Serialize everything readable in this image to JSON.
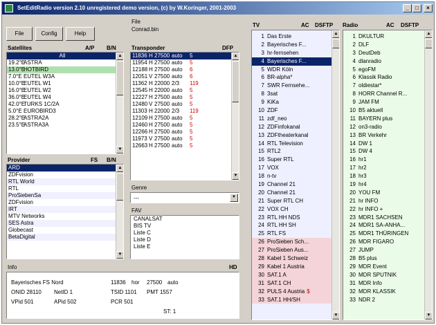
{
  "window": {
    "title": "SetEditRadio version 2.10 unregistered demo version, (c) by W.Koringer, 2001-2003",
    "min_label": "_",
    "max_label": "□",
    "close_label": "×"
  },
  "toolbar": {
    "file_label": "File",
    "config_label": "Config",
    "help_label": "Help"
  },
  "file": {
    "label": "File",
    "value": "Conrad.bin"
  },
  "satellites": {
    "header": "Satellites",
    "col_ap": "A/P",
    "col_dis": "B/N",
    "items": [
      {
        "pos": "",
        "name": "All",
        "selected": true
      },
      {
        "pos": "19.2°E",
        "name": "ASTRA"
      },
      {
        "pos": "13.0°E",
        "name": "HOTBIRD",
        "highlight": true
      },
      {
        "pos": "7.0°E",
        "name": "EUTEL W3A"
      },
      {
        "pos": "10.0°E",
        "name": "EUTEL W1"
      },
      {
        "pos": "16.0°E",
        "name": "EUTEL W2"
      },
      {
        "pos": "36.0°E",
        "name": "EUTEL W4"
      },
      {
        "pos": "42.0°E",
        "name": "TURKS 1C/2A"
      },
      {
        "pos": "5.0°E",
        "name": "EUROBIRD3"
      },
      {
        "pos": "28.2°E",
        "name": "ASTRA2A"
      },
      {
        "pos": "23.5°E",
        "name": "ASTRA3A"
      }
    ]
  },
  "transponders": {
    "header": "Transponder",
    "col_dis": "DFP",
    "items": [
      {
        "freq": "11836",
        "pol": "H",
        "sr": "27500",
        "fec": "auto",
        "n": "5",
        "selected": true
      },
      {
        "freq": "11954",
        "pol": "H",
        "sr": "27500",
        "fec": "auto",
        "n": "5"
      },
      {
        "freq": "12188",
        "pol": "H",
        "sr": "27500",
        "fec": "auto",
        "n": "6"
      },
      {
        "freq": "12051",
        "pol": "V",
        "sr": "27500",
        "fec": "auto",
        "n": "6"
      },
      {
        "freq": "11362",
        "pol": "H",
        "sr": "22000",
        "fec": "2/3",
        "n": "119"
      },
      {
        "freq": "12545",
        "pol": "H",
        "sr": "22000",
        "fec": "auto",
        "n": "5"
      },
      {
        "freq": "12227",
        "pol": "H",
        "sr": "27500",
        "fec": "auto",
        "n": "5"
      },
      {
        "freq": "12480",
        "pol": "V",
        "sr": "27500",
        "fec": "auto",
        "n": "5"
      },
      {
        "freq": "11303",
        "pol": "H",
        "sr": "22000",
        "fec": "2/3",
        "n": "119"
      },
      {
        "freq": "12109",
        "pol": "H",
        "sr": "27500",
        "fec": "auto",
        "n": "5"
      },
      {
        "freq": "12460",
        "pol": "H",
        "sr": "27500",
        "fec": "auto",
        "n": "5"
      },
      {
        "freq": "12266",
        "pol": "H",
        "sr": "27500",
        "fec": "auto",
        "n": "5"
      },
      {
        "freq": "11973",
        "pol": "V",
        "sr": "27500",
        "fec": "auto",
        "n": "5"
      },
      {
        "freq": "12663",
        "pol": "H",
        "sr": "27500",
        "fec": "auto",
        "n": "5"
      }
    ]
  },
  "providers": {
    "header": "Provider",
    "col_fs": "FS",
    "col_dis": "B/N",
    "items": [
      {
        "name": "ARD",
        "selected": true
      },
      {
        "name": "ZDFvision"
      },
      {
        "name": "RTL World"
      },
      {
        "name": "RTL"
      },
      {
        "name": "ProSiebenSa"
      },
      {
        "name": "ZDFvision"
      },
      {
        "name": "IRT"
      },
      {
        "name": "MTV Networks"
      },
      {
        "name": "SES Astra"
      },
      {
        "name": "Globecast"
      },
      {
        "name": "BetaDigital"
      }
    ]
  },
  "genre": {
    "label": "Genre",
    "value": "---"
  },
  "fav": {
    "label": "FAV",
    "items": [
      {
        "name": "CANALSAT"
      },
      {
        "name": "BIS TV"
      },
      {
        "name": "Liste  C"
      },
      {
        "name": "Liste  D"
      },
      {
        "name": "Liste  E"
      }
    ]
  },
  "info": {
    "label": "Info",
    "hd": "HD",
    "name": "Bayerisches FS Nord",
    "freq": "11836",
    "pol": "hor",
    "sr": "27500",
    "fec": "auto",
    "onid": "ONID 28110",
    "netid": "NetID 1",
    "tsid": "TSID 1101",
    "pmt": "PMT 1557",
    "vpid": "VPid 501",
    "apid": "APid 502",
    "pcr": "PCR 501",
    "st": "ST: 1"
  },
  "tv": {
    "label": "TV",
    "ac": "AC",
    "dsftp": "DSFTP",
    "items": [
      {
        "n": "1",
        "name": "Das Erste"
      },
      {
        "n": "2",
        "name": "Bayerisches F..."
      },
      {
        "n": "3",
        "name": "hr-fernsehen"
      },
      {
        "n": "4",
        "name": "Bayerisches F...",
        "selected": true
      },
      {
        "n": "5",
        "name": "WDR Köln"
      },
      {
        "n": "6",
        "name": "BR-alpha*"
      },
      {
        "n": "7",
        "name": "SWR Fernsehe..."
      },
      {
        "n": "8",
        "name": "3sat"
      },
      {
        "n": "9",
        "name": "KiKa"
      },
      {
        "n": "10",
        "name": "ZDF"
      },
      {
        "n": "11",
        "name": "zdf_neo"
      },
      {
        "n": "12",
        "name": "ZDFinfokanal"
      },
      {
        "n": "13",
        "name": "ZDFtheaterkanal"
      },
      {
        "n": "14",
        "name": "RTL Television"
      },
      {
        "n": "15",
        "name": "RTL2"
      },
      {
        "n": "16",
        "name": "Super RTL"
      },
      {
        "n": "17",
        "name": "VOX"
      },
      {
        "n": "18",
        "name": "n-tv"
      },
      {
        "n": "19",
        "name": "Channel 21"
      },
      {
        "n": "20",
        "name": "Channel 21"
      },
      {
        "n": "21",
        "name": "Super RTL CH"
      },
      {
        "n": "22",
        "name": "VOX CH"
      },
      {
        "n": "23",
        "name": "RTL HH NDS"
      },
      {
        "n": "24",
        "name": "RTL HH SH"
      },
      {
        "n": "25",
        "name": "RTL FS"
      },
      {
        "n": "26",
        "name": "ProSieben Sch...",
        "pink": true
      },
      {
        "n": "27",
        "name": "ProSieben Aus...",
        "pink": true
      },
      {
        "n": "28",
        "name": "Kabel 1 Schweiz",
        "pink": true
      },
      {
        "n": "29",
        "name": "Kabel 1 Austria",
        "pink": true
      },
      {
        "n": "30",
        "name": "SAT.1 A",
        "pink": true
      },
      {
        "n": "31",
        "name": "SAT.1 CH",
        "pink": true
      },
      {
        "n": "32",
        "name": "PULS 4 Austria",
        "pink": true,
        "flag": "$"
      },
      {
        "n": "33",
        "name": "SAT.1 HH/SH",
        "pink": true
      }
    ]
  },
  "radio": {
    "label": "Radio",
    "ac": "AC",
    "dsftp": "DSFTP",
    "items": [
      {
        "n": "1",
        "name": "DKULTUR"
      },
      {
        "n": "2",
        "name": "DLF"
      },
      {
        "n": "3",
        "name": "DeutDeb"
      },
      {
        "n": "4",
        "name": "dlanradio"
      },
      {
        "n": "5",
        "name": "egoFM"
      },
      {
        "n": "6",
        "name": "Klassik Radio"
      },
      {
        "n": "7",
        "name": "oldiestar*"
      },
      {
        "n": "8",
        "name": "HORR Channel R..."
      },
      {
        "n": "9",
        "name": "JAM FM"
      },
      {
        "n": "10",
        "name": "B5 aktuell"
      },
      {
        "n": "11",
        "name": "BAYERN plus"
      },
      {
        "n": "12",
        "name": "on3-radio"
      },
      {
        "n": "13",
        "name": "BR Verkehr"
      },
      {
        "n": "14",
        "name": "DW 1"
      },
      {
        "n": "15",
        "name": "DW 4"
      },
      {
        "n": "16",
        "name": "hr1"
      },
      {
        "n": "17",
        "name": "hr2"
      },
      {
        "n": "18",
        "name": "hr3"
      },
      {
        "n": "19",
        "name": "hr4"
      },
      {
        "n": "20",
        "name": "YOU FM"
      },
      {
        "n": "21",
        "name": "hr INFO"
      },
      {
        "n": "22",
        "name": "hr INFO +"
      },
      {
        "n": "23",
        "name": "MDR1 SACHSEN"
      },
      {
        "n": "24",
        "name": "MDR1 SA-ANHA..."
      },
      {
        "n": "25",
        "name": "MDR1 THÜRINGEN"
      },
      {
        "n": "26",
        "name": "MDR FIGARO"
      },
      {
        "n": "27",
        "name": "JUMP"
      },
      {
        "n": "28",
        "name": "B5 plus"
      },
      {
        "n": "29",
        "name": "MDR Event"
      },
      {
        "n": "30",
        "name": "MDR SPUTNIK"
      },
      {
        "n": "31",
        "name": "MDR Info"
      },
      {
        "n": "32",
        "name": "MDR KLASSIK"
      },
      {
        "n": "33",
        "name": "NDR 2"
      }
    ]
  },
  "colors": {
    "selection": "#0a246a",
    "highlight_green": "#b0e0b0",
    "pink_row": "#f4d4d8",
    "tv_bg": "#eef0ff",
    "radio_bg": "#eafce8",
    "flag_red": "#d00000"
  }
}
